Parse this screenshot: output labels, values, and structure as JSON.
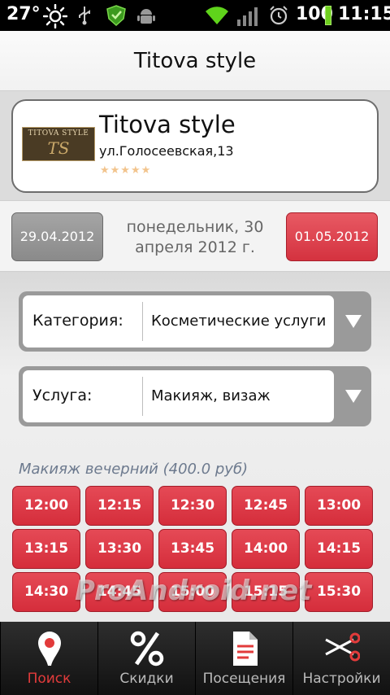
{
  "status_bar": {
    "temperature": "27°",
    "battery": "100",
    "time": "11:15",
    "icons": [
      "sun-icon",
      "usb-icon",
      "shield-icon",
      "android-icon",
      "wifi-icon",
      "signal-icon",
      "alarm-icon",
      "battery-icon"
    ]
  },
  "header": {
    "title": "Titova style"
  },
  "salon": {
    "logo_text": "TITOVA STYLE",
    "logo_monogram": "TS",
    "name": "Titova style",
    "address": "ул.Голосеевская,13",
    "rating_stars": "★★★★★",
    "rating": 5
  },
  "dates": {
    "prev": "29.04.2012",
    "current": "понедельник, 30 апреля 2012 г.",
    "next": "01.05.2012"
  },
  "filters": {
    "category_label": "Категория:",
    "category_value": "Косметические услуги",
    "service_label": "Услуга:",
    "service_value": "Макияж, визаж"
  },
  "service": {
    "title": "Макияж вечерний  (400.0 руб)"
  },
  "slots": [
    "12:00",
    "12:15",
    "12:30",
    "12:45",
    "13:00",
    "13:15",
    "13:30",
    "13:45",
    "14:00",
    "14:15",
    "14:30",
    "14:45",
    "15:00",
    "15:15",
    "15:30"
  ],
  "watermark": "ProAndroid.net",
  "tabs": [
    {
      "label": "Поиск",
      "icon": "map-pin-icon"
    },
    {
      "label": "Скидки",
      "icon": "percent-icon"
    },
    {
      "label": "Посещения",
      "icon": "document-icon"
    },
    {
      "label": "Настройки",
      "icon": "scissors-icon"
    }
  ],
  "colors": {
    "accent_red": "#d52d3b",
    "tab_active": "#e23b3b",
    "battery_green": "#6fcf1f"
  }
}
